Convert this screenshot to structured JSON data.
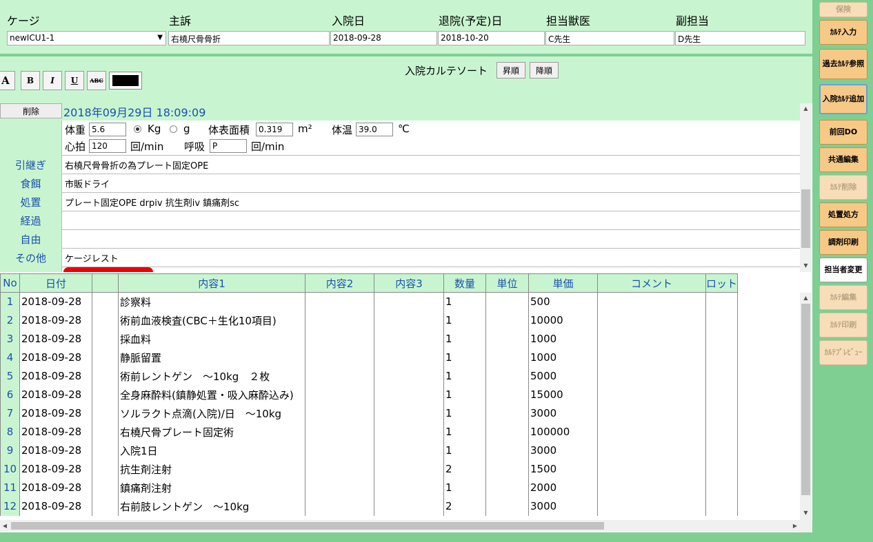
{
  "header": {
    "labels": {
      "cage": "ケージ",
      "complaint": "主訴",
      "admission": "入院日",
      "discharge": "退院(予定)日",
      "vet": "担当獣医",
      "sub_vet": "副担当"
    },
    "values": {
      "cage": "newICU1-1",
      "complaint": "右橈尺骨骨折",
      "admission": "2018-09-28",
      "discharge": "2018-10-20",
      "vet": "C先生",
      "sub_vet": "D先生"
    }
  },
  "toolbar": {
    "font_buttons": {
      "size": "A",
      "bold": "B",
      "italic": "I",
      "underline": "U",
      "strike": "ABC"
    },
    "sort_label": "入院カルテソート",
    "asc": "昇順",
    "desc": "降順",
    "text_color": "#000000"
  },
  "record": {
    "delete": "削除",
    "datetime": "2018年09月29日 18:09:09",
    "vitals": {
      "weight_label": "体重",
      "weight": "5.6",
      "unit_kg": "Kg",
      "unit_g": "g",
      "bsa_label": "体表面積",
      "bsa": "0.319",
      "bsa_unit": "m²",
      "temp_label": "体温",
      "temp": "39.0",
      "temp_unit": "℃",
      "hr_label": "心拍",
      "hr": "120",
      "hr_unit": "回/min",
      "rr_label": "呼吸",
      "rr": "P",
      "rr_unit": "回/min"
    },
    "rows": [
      {
        "label": "引継ぎ",
        "value": "右橈尺骨骨折の為プレート固定OPE"
      },
      {
        "label": "食餌",
        "value": "市販ドライ"
      },
      {
        "label": "処置",
        "value": "プレート固定OPE drpiv 抗生剤iv 鎮痛剤sc"
      },
      {
        "label": "経過",
        "value": ""
      },
      {
        "label": "自由",
        "value": ""
      },
      {
        "label": "その他",
        "value": "ケージレスト"
      }
    ]
  },
  "table": {
    "headers": [
      "No",
      "日付",
      "",
      "内容1",
      "内容2",
      "内容3",
      "数量",
      "単位",
      "単価",
      "コメント",
      "ロット"
    ],
    "rows": [
      [
        "1",
        "2018-09-28",
        "",
        "診察料",
        "",
        "",
        "1",
        "",
        "500",
        "",
        ""
      ],
      [
        "2",
        "2018-09-28",
        "",
        "術前血液検査(CBC＋生化10項目)",
        "",
        "",
        "1",
        "",
        "10000",
        "",
        ""
      ],
      [
        "3",
        "2018-09-28",
        "",
        "採血料",
        "",
        "",
        "1",
        "",
        "1000",
        "",
        ""
      ],
      [
        "4",
        "2018-09-28",
        "",
        "静脈留置",
        "",
        "",
        "1",
        "",
        "1000",
        "",
        ""
      ],
      [
        "5",
        "2018-09-28",
        "",
        "術前レントゲン　～10kg　２枚",
        "",
        "",
        "1",
        "",
        "5000",
        "",
        ""
      ],
      [
        "6",
        "2018-09-28",
        "",
        "全身麻酔料(鎮静処置・吸入麻酔込み)",
        "",
        "",
        "1",
        "",
        "15000",
        "",
        ""
      ],
      [
        "7",
        "2018-09-28",
        "",
        "ソルラクト点滴(入院)/日　～10kg",
        "",
        "",
        "1",
        "",
        "3000",
        "",
        ""
      ],
      [
        "8",
        "2018-09-28",
        "",
        "右橈尺骨プレート固定術",
        "",
        "",
        "1",
        "",
        "100000",
        "",
        ""
      ],
      [
        "9",
        "2018-09-28",
        "",
        "入院1日",
        "",
        "",
        "1",
        "",
        "3000",
        "",
        ""
      ],
      [
        "10",
        "2018-09-28",
        "",
        "抗生剤注射",
        "",
        "",
        "2",
        "",
        "1500",
        "",
        ""
      ],
      [
        "11",
        "2018-09-28",
        "",
        "鎮痛剤注射",
        "",
        "",
        "1",
        "",
        "2000",
        "",
        ""
      ],
      [
        "12",
        "2018-09-28",
        "",
        "右前肢レントゲン　～10kg",
        "",
        "",
        "2",
        "",
        "3000",
        "",
        ""
      ]
    ]
  },
  "sidebar": [
    {
      "label": "保険",
      "state": "disabled"
    },
    {
      "label": "ｶﾙﾃ入力",
      "state": "normal"
    },
    {
      "label": "過去ｶﾙﾃ参照",
      "state": "normal"
    },
    {
      "label": "入院ｶﾙﾃ追加",
      "state": "active"
    },
    {
      "label": "前回DO",
      "state": "normal"
    },
    {
      "label": "共通編集",
      "state": "normal"
    },
    {
      "label": "ｶﾙﾃ削除",
      "state": "disabled"
    },
    {
      "label": "処置処方",
      "state": "normal"
    },
    {
      "label": "調剤印刷",
      "state": "normal"
    },
    {
      "label": "担当者変更",
      "state": "white"
    },
    {
      "label": "ｶﾙﾃ編集",
      "state": "disabled"
    },
    {
      "label": "ｶﾙﾃ印刷",
      "state": "disabled"
    },
    {
      "label": "ｶﾙﾃﾌﾟﾚﾋﾞｭｰ",
      "state": "disabled"
    }
  ]
}
